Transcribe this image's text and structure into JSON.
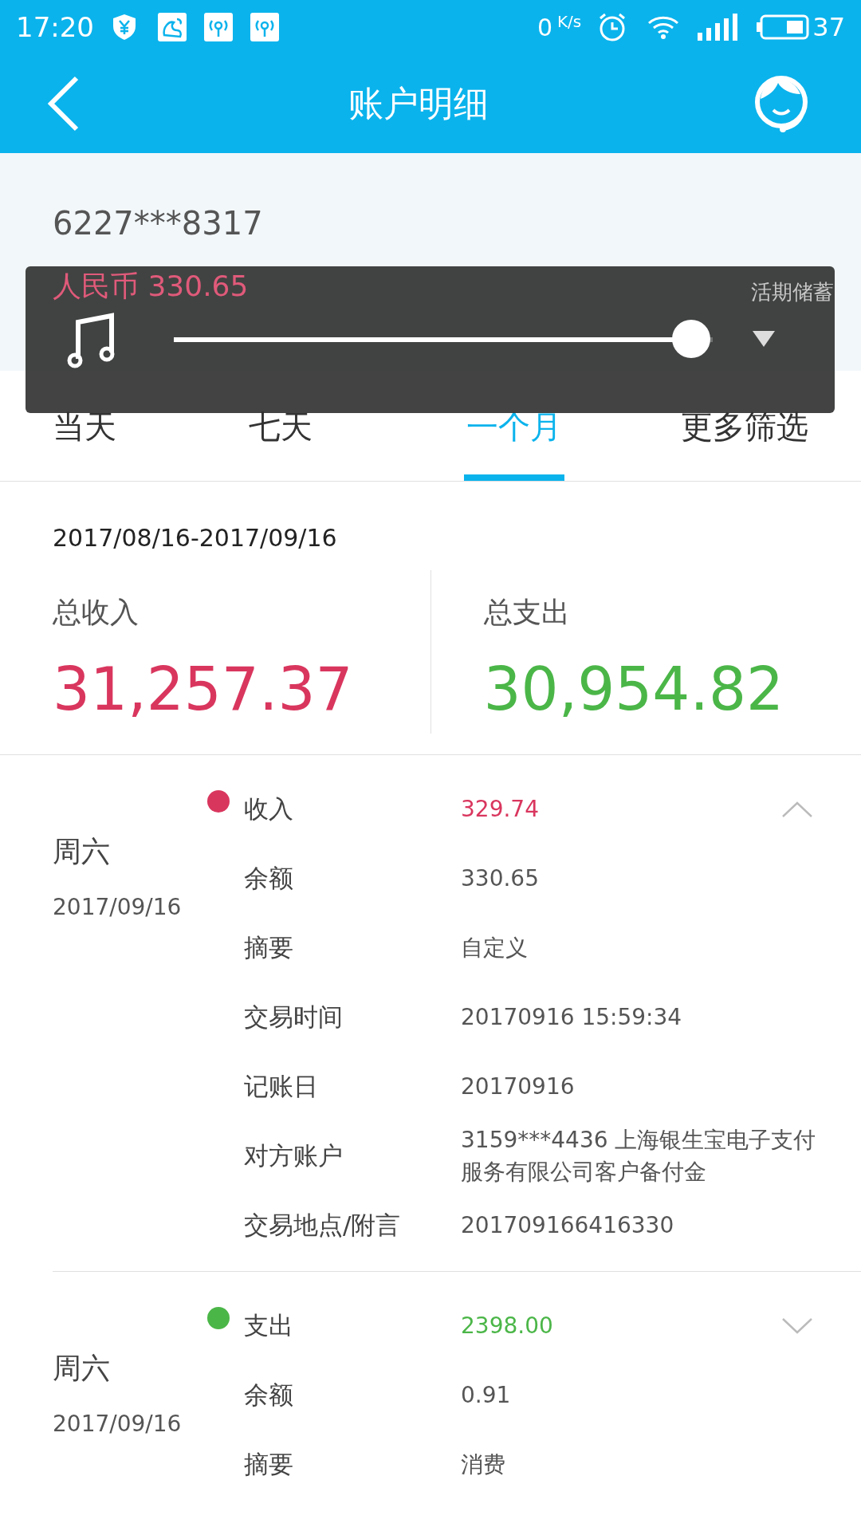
{
  "status_bar": {
    "time": "17:20",
    "net_speed_value": "0",
    "net_speed_unit": "K/s",
    "battery": "37"
  },
  "header": {
    "title": "账户明细"
  },
  "account": {
    "number": "6227***8317",
    "balance": "人民币 330.65",
    "type": "活期储蓄"
  },
  "volume_overlay": {
    "level": 0.96
  },
  "tabs": [
    {
      "label": "当天",
      "selected": false
    },
    {
      "label": "七天",
      "selected": false
    },
    {
      "label": "一个月",
      "selected": true
    },
    {
      "label": "更多筛选",
      "selected": false
    }
  ],
  "period": "2017/08/16-2017/09/16",
  "totals": [
    {
      "kind": "income",
      "label": "总收入",
      "amount": "31,257.37"
    },
    {
      "kind": "expense",
      "label": "总支出",
      "amount": "30,954.82"
    }
  ],
  "transactions": [
    {
      "kind": "income",
      "color": "#d9365e",
      "expanded": true,
      "weekday": "周六",
      "date": "2017/09/16",
      "fields": [
        {
          "label": "收入",
          "value": "329.74"
        },
        {
          "label": "余额",
          "value": "330.65"
        },
        {
          "label": "摘要",
          "value": "自定义"
        },
        {
          "label": "交易时间",
          "value": "20170916 15:59:34"
        },
        {
          "label": "记账日",
          "value": "20170916"
        },
        {
          "label": "对方账户",
          "value": "3159***4436 上海银生宝电子支付服务有限公司客户备付金"
        },
        {
          "label": "交易地点/附言",
          "value": "201709166416330"
        }
      ]
    },
    {
      "kind": "expense",
      "color": "#4bb648",
      "expanded": false,
      "weekday": "周六",
      "date": "2017/09/16",
      "fields": [
        {
          "label": "支出",
          "value": "2398.00"
        },
        {
          "label": "余额",
          "value": "0.91"
        },
        {
          "label": "摘要",
          "value": "消费"
        }
      ]
    }
  ]
}
